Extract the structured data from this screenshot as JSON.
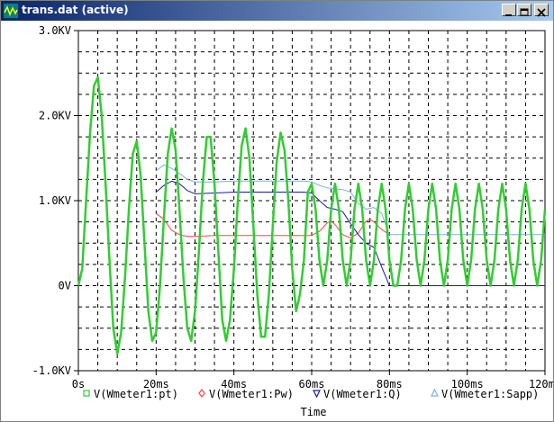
{
  "window": {
    "title": "trans.dat (active)",
    "controls": {
      "minimize": "minimize",
      "maximize": "maximize",
      "close": "close"
    }
  },
  "colors": {
    "titlebar": "#0a246a",
    "pt": "#33cc33",
    "pw": "#ff4444",
    "q": "#1a1aa6",
    "sapp": "#7ab0e0",
    "grid": "#000000"
  },
  "chart_data": {
    "type": "line",
    "xlabel": "Time",
    "ylabel": "",
    "xlim": [
      0,
      120
    ],
    "ylim": [
      -1000,
      3000
    ],
    "x_ticks": [
      "0s",
      "20ms",
      "40ms",
      "60ms",
      "80ms",
      "100ms",
      "120ms"
    ],
    "y_ticks": [
      "-1.0KV",
      "0V",
      "1.0KV",
      "2.0KV",
      "3.0KV"
    ],
    "grid": true,
    "legend_position": "bottom",
    "series": [
      {
        "name": "V(Wmeter1:pt)",
        "marker": "square",
        "color": "#33cc33",
        "x": [
          0,
          1,
          2,
          3,
          4,
          5,
          6,
          7,
          8,
          9,
          10,
          11,
          12,
          13,
          14,
          15,
          16,
          17,
          18,
          19,
          20,
          21,
          22,
          23,
          24,
          25,
          26,
          27,
          28,
          29,
          30,
          31,
          32,
          33,
          34,
          35,
          36,
          37,
          38,
          39,
          40,
          41,
          42,
          43,
          44,
          45,
          46,
          47,
          48,
          49,
          50,
          51,
          52,
          53,
          54,
          55,
          56,
          57,
          58,
          59,
          60,
          61,
          62,
          63,
          64,
          65,
          66,
          67,
          68,
          69,
          70,
          71,
          72,
          73,
          74,
          75,
          76,
          77,
          78,
          79,
          80,
          81,
          82,
          83,
          84,
          85,
          86,
          87,
          88,
          89,
          90,
          91,
          92,
          93,
          94,
          95,
          96,
          97,
          98,
          99,
          100,
          101,
          102,
          103,
          104,
          105,
          106,
          107,
          108,
          109,
          110,
          111,
          112,
          113,
          114,
          115,
          116,
          117,
          118,
          119,
          120
        ],
        "y": [
          0,
          200,
          1000,
          1800,
          2350,
          2450,
          2000,
          1200,
          300,
          -500,
          -800,
          -550,
          100,
          900,
          1550,
          1700,
          1300,
          500,
          -300,
          -650,
          -550,
          0,
          800,
          1550,
          1850,
          1600,
          900,
          100,
          -500,
          -650,
          -300,
          400,
          1200,
          1750,
          1750,
          1200,
          400,
          -400,
          -650,
          -400,
          200,
          1000,
          1650,
          1850,
          1500,
          700,
          -100,
          -600,
          -600,
          -100,
          700,
          1450,
          1800,
          1600,
          1000,
          200,
          -300,
          -100,
          300,
          1100,
          1200,
          900,
          300,
          0,
          300,
          900,
          1200,
          900,
          300,
          0,
          300,
          900,
          1200,
          900,
          300,
          0,
          300,
          900,
          1200,
          900,
          300,
          0,
          0,
          300,
          900,
          1200,
          900,
          300,
          0,
          300,
          900,
          1200,
          900,
          300,
          0,
          300,
          900,
          1200,
          900,
          300,
          0,
          300,
          900,
          1200,
          900,
          300,
          0,
          300,
          900,
          1200,
          900,
          300,
          0,
          300,
          900,
          1200,
          900,
          300,
          0,
          300,
          900
        ]
      },
      {
        "name": "V(Wmeter1:Pw)",
        "marker": "diamond",
        "color": "#ff4444",
        "x": [
          20,
          22,
          24,
          26,
          28,
          30,
          35,
          40,
          45,
          50,
          55,
          58,
          60,
          62,
          64,
          65,
          66,
          68,
          70,
          72,
          74,
          75,
          76,
          78,
          80
        ],
        "y": [
          850,
          780,
          650,
          600,
          580,
          580,
          590,
          590,
          590,
          590,
          590,
          590,
          590,
          640,
          740,
          760,
          720,
          600,
          560,
          620,
          760,
          780,
          750,
          660,
          600
        ]
      },
      {
        "name": "V(Wmeter1:Q)",
        "marker": "down-triangle",
        "color": "#1a1aa6",
        "x": [
          20,
          22,
          24,
          26,
          28,
          30,
          35,
          40,
          45,
          50,
          55,
          58,
          60,
          62,
          64,
          66,
          68,
          70,
          72,
          74,
          76,
          78,
          80,
          82,
          85,
          90,
          95,
          100,
          105,
          110,
          115,
          120
        ],
        "y": [
          1100,
          1180,
          1230,
          1200,
          1120,
          1080,
          1090,
          1100,
          1100,
          1100,
          1100,
          1100,
          1090,
          1000,
          920,
          900,
          870,
          730,
          600,
          500,
          450,
          220,
          0,
          0,
          0,
          0,
          0,
          0,
          0,
          0,
          0,
          0
        ]
      },
      {
        "name": "V(Wmeter1:Sapp)",
        "marker": "up-triangle",
        "color": "#7ab0e0",
        "x": [
          20,
          22,
          24,
          26,
          28,
          30,
          35,
          40,
          45,
          50,
          55,
          58,
          60,
          62,
          64,
          66,
          68,
          70,
          72,
          74,
          76,
          78,
          80,
          82,
          85,
          90,
          95,
          100,
          105,
          110,
          115,
          120
        ],
        "y": [
          1350,
          1420,
          1380,
          1320,
          1250,
          1220,
          1220,
          1230,
          1230,
          1230,
          1230,
          1230,
          1220,
          1180,
          1150,
          1140,
          1130,
          1100,
          970,
          900,
          920,
          850,
          600,
          600,
          600,
          600,
          600,
          600,
          600,
          600,
          600,
          600
        ]
      }
    ]
  }
}
